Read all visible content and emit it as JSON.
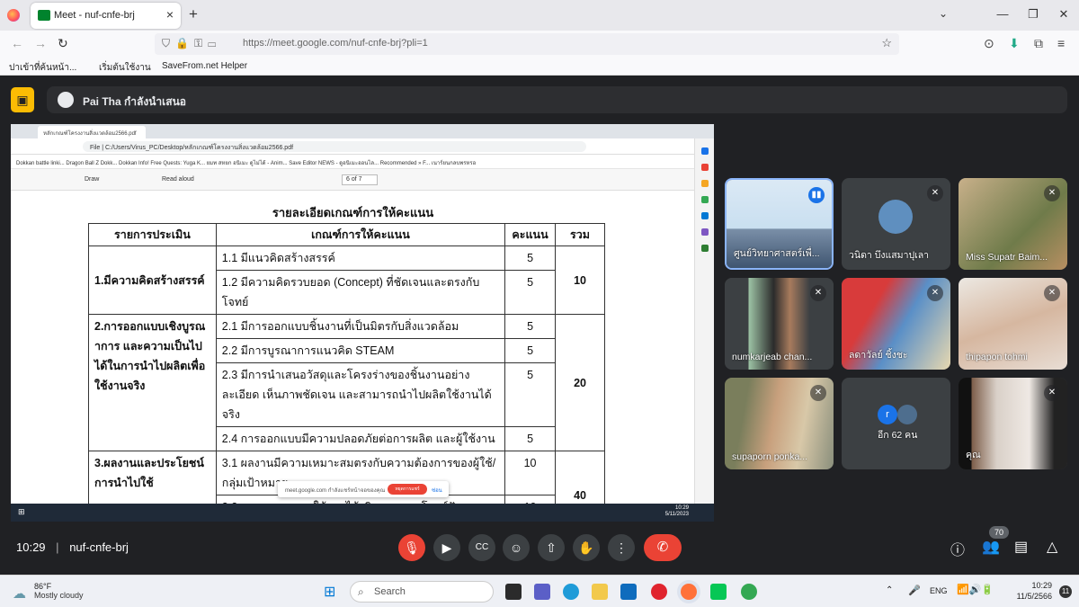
{
  "browser": {
    "tab_title": "Meet - nuf-cnfe-brj",
    "url": "https://meet.google.com/nuf-cnfe-brj?pli=1",
    "bookmarks": [
      "ปาเข้าที่ค้นหน้า...",
      "เริ่มต้นใช้งาน",
      "SaveFrom.net Helper"
    ]
  },
  "presenter": {
    "text": "Pai Tha กำลังนำเสนอ"
  },
  "shared": {
    "tab_title": "หลักเกณฑ์โครงงานสิ่งแวดล้อม2566.pdf",
    "path": "C:/Users/Virus_PC/Desktop/หลักเกณฑ์โครงงานสิ่งแวดล้อม2566.pdf",
    "file_label": "File",
    "bookmarks": "Dokkan battle linki...   Dragon Ball Z Dokk...   Dokkan Info!   Free Quests: Yuga K...   ยมท   สหยก   อนิเมะ ดูไม่ได้ - Anim...   Save Editor   NEWS - ดูอนิเมะออนไล...   Recommended » F...   เนาร์ยนกลบพรหรอ",
    "draw_label": "Draw",
    "read_aloud": "Read aloud",
    "page_num": "6",
    "page_total": "of 7",
    "doc_title": "รายละเอียดเกณฑ์การให้คะแนน",
    "headers": [
      "รายการประเมิน",
      "เกณฑ์การให้คะแนน",
      "คะแนน",
      "รวม"
    ],
    "section1": "1.มีความคิดสร้างสรรค์",
    "s1_total": "10",
    "c11": "1.1 มีแนวคิดสร้างสรรค์",
    "p11": "5",
    "c12": "1.2 มีความคิดรวบยอด (Concept) ที่ชัดเจนและตรงกับโจทย์",
    "p12": "5",
    "section2": "2.การออกแบบเชิงบูรณาการ และความเป็นไปได้ในการนำไปผลิตเพื่อใช้งานจริง",
    "s2_total": "20",
    "c21": "2.1 มีการออกแบบชิ้นงานที่เป็นมิตรกับสิ่งแวดล้อม",
    "p21": "5",
    "c22": "2.2 มีการบูรณาการแนวคิด STEAM",
    "p22": "5",
    "c23": "2.3 มีการนำเสนอวัสดุและโครงร่างของชิ้นงานอย่างละเอียด เห็นภาพชัดเจน และสามารถนำไปผลิตใช้งานได้จริง",
    "p23": "5",
    "c24": "2.4 การออกแบบมีความปลอดภัยต่อการผลิต และผู้ใช้งาน",
    "p24": "5",
    "section3": "3.ผลงานและประโยชน์การนำไปใช้",
    "s3_total": "40",
    "c31": "3.1 ผลงานมีความเหมาะสมตรงกับความต้องการของผู้ใช้/กลุ่มเป้าหมาย",
    "p31": "10",
    "c32": "3.2 ผลงานสามารถใช้งานได้จริง และตอบโจทย์ปัญหาตามที่ต้องการได้",
    "p32": "10",
    "toast_text": "meet.google.com กำลังแชร์หน้าจอของคุณ",
    "toast_stop": "หยุดการแชร์",
    "toast_hide": "ซ่อน",
    "task_time": "10:29",
    "task_date": "5/11/2023"
  },
  "participants": [
    {
      "name": "ศูนย์วิทยาศาสตร์เพื่...",
      "speaking": true
    },
    {
      "name": "วนิดา บึงแสมาปุเลา",
      "muted": true
    },
    {
      "name": "Miss Supatr Baim...",
      "muted": true
    },
    {
      "name": "numkarjeab chan...",
      "muted": true
    },
    {
      "name": "ลดาวัลย์ ชิ้งชะ",
      "muted": true
    },
    {
      "name": "thipapon tohmi",
      "muted": true
    },
    {
      "name": "supaporn ponka...",
      "muted": true
    },
    {
      "name": "อีก 62 คน",
      "initial": "r"
    },
    {
      "name": "คุณ",
      "muted": true
    }
  ],
  "meeting": {
    "time": "10:29",
    "code": "nuf-cnfe-brj",
    "participant_count": "70"
  },
  "taskbar": {
    "temp": "86°F",
    "weather": "Mostly cloudy",
    "search": "Search",
    "lang": "ENG",
    "time": "10:29",
    "date": "11/5/2566",
    "notif": "11"
  },
  "colors": {
    "accent_red": "#ea4335",
    "present_yellow": "#fbbc04",
    "meet_bg": "#202124"
  }
}
